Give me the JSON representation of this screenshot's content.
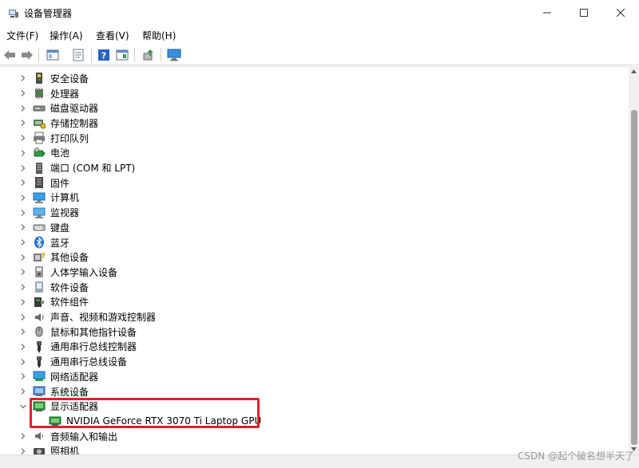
{
  "window": {
    "title": "设备管理器",
    "minimize_glyph": "—",
    "maximize_glyph": "☐",
    "close_glyph": "✕"
  },
  "menu": [
    "文件(F)",
    "操作(A)",
    "查看(V)",
    "帮助(H)"
  ],
  "tree": [
    {
      "label": "安全设备",
      "icon": "security-key-icon",
      "expanded": false
    },
    {
      "label": "处理器",
      "icon": "processor-icon",
      "expanded": false
    },
    {
      "label": "磁盘驱动器",
      "icon": "disk-drive-icon",
      "expanded": false
    },
    {
      "label": "存储控制器",
      "icon": "storage-controller-icon",
      "expanded": false
    },
    {
      "label": "打印队列",
      "icon": "printer-icon",
      "expanded": false
    },
    {
      "label": "电池",
      "icon": "battery-icon",
      "expanded": false
    },
    {
      "label": "端口 (COM 和 LPT)",
      "icon": "port-icon",
      "expanded": false
    },
    {
      "label": "固件",
      "icon": "firmware-icon",
      "expanded": false
    },
    {
      "label": "计算机",
      "icon": "computer-icon",
      "expanded": false
    },
    {
      "label": "监视器",
      "icon": "monitor-icon",
      "expanded": false
    },
    {
      "label": "键盘",
      "icon": "keyboard-icon",
      "expanded": false
    },
    {
      "label": "蓝牙",
      "icon": "bluetooth-icon",
      "expanded": false
    },
    {
      "label": "其他设备",
      "icon": "other-devices-icon",
      "expanded": false
    },
    {
      "label": "人体学输入设备",
      "icon": "hid-icon",
      "expanded": false
    },
    {
      "label": "软件设备",
      "icon": "software-device-icon",
      "expanded": false
    },
    {
      "label": "软件组件",
      "icon": "software-component-icon",
      "expanded": false
    },
    {
      "label": "声音、视频和游戏控制器",
      "icon": "sound-icon",
      "expanded": false
    },
    {
      "label": "鼠标和其他指针设备",
      "icon": "mouse-icon",
      "expanded": false
    },
    {
      "label": "通用串行总线控制器",
      "icon": "usb-icon",
      "expanded": false
    },
    {
      "label": "通用串行总线设备",
      "icon": "usb-icon",
      "expanded": false
    },
    {
      "label": "网络适配器",
      "icon": "network-adapter-icon",
      "expanded": false
    },
    {
      "label": "系统设备",
      "icon": "system-device-icon",
      "expanded": false
    },
    {
      "label": "显示适配器",
      "icon": "display-adapter-icon",
      "expanded": true
    },
    {
      "label": "NVIDIA GeForce RTX 3070 Ti Laptop GPU",
      "icon": "gpu-icon",
      "child": true
    },
    {
      "label": "音频输入和输出",
      "icon": "audio-io-icon",
      "expanded": false
    },
    {
      "label": "照相机",
      "icon": "camera-icon",
      "expanded": false
    }
  ],
  "watermark": "CSDN @起个破名想半天了",
  "colors": {
    "highlight": "#e0202a"
  }
}
